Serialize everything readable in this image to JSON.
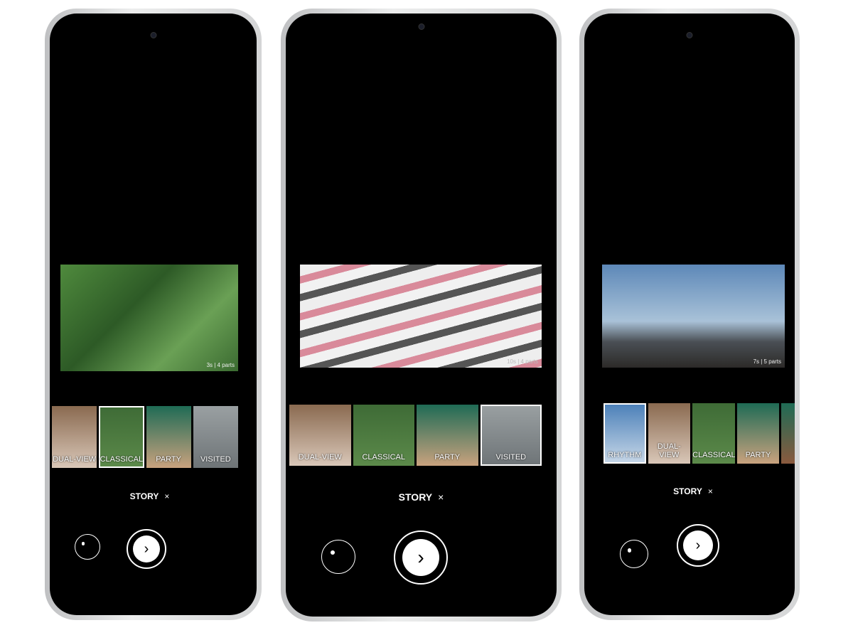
{
  "phones": [
    {
      "video_info": "3s | 4 parts",
      "thumbs": [
        "DUAL-VIEW",
        "CLASSICAL",
        "PARTY",
        "VISITED"
      ],
      "selected": 1,
      "story": "STORY",
      "close": "×"
    },
    {
      "video_info": "10s | 4 parts",
      "thumbs": [
        "DUAL-VIEW",
        "CLASSICAL",
        "PARTY",
        "VISITED"
      ],
      "selected": 3,
      "story": "STORY",
      "close": "×"
    },
    {
      "video_info": "7s | 5 parts",
      "thumbs": [
        "RHYTHM",
        "DUAL-VIEW",
        "CLASSICAL",
        "PARTY",
        ""
      ],
      "selected": 0,
      "story": "STORY",
      "close": "×"
    }
  ],
  "icons": {
    "effect": "sticker-face-icon",
    "next": "chevron-right-icon"
  }
}
